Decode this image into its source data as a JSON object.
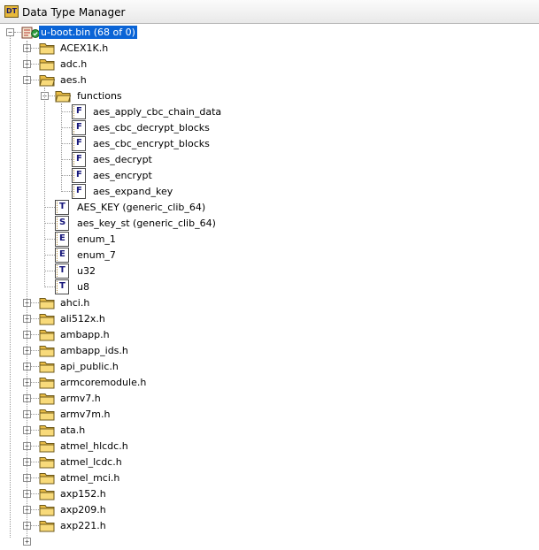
{
  "window": {
    "title": "Data Type Manager"
  },
  "root": {
    "label": "u-boot.bin (68 of 0)"
  },
  "before_aes": [
    "ACEX1K.h",
    "adc.h"
  ],
  "aes": {
    "label": "aes.h",
    "functions_folder": "functions",
    "functions": [
      "aes_apply_cbc_chain_data",
      "aes_cbc_decrypt_blocks",
      "aes_cbc_encrypt_blocks",
      "aes_decrypt",
      "aes_encrypt",
      "aes_expand_key"
    ],
    "types": [
      {
        "label": "AES_KEY  (generic_clib_64)",
        "icon": "typedef-icon",
        "glyph": "T"
      },
      {
        "label": "aes_key_st  (generic_clib_64)",
        "icon": "struct-icon",
        "glyph": "S"
      },
      {
        "label": "enum_1",
        "icon": "enum-icon",
        "glyph": "E"
      },
      {
        "label": "enum_7",
        "icon": "enum-icon",
        "glyph": "E"
      },
      {
        "label": "u32",
        "icon": "typedef-icon",
        "glyph": "T"
      },
      {
        "label": "u8",
        "icon": "typedef-icon",
        "glyph": "T"
      }
    ]
  },
  "after_aes": [
    "ahci.h",
    "ali512x.h",
    "ambapp.h",
    "ambapp_ids.h",
    "api_public.h",
    "armcoremodule.h",
    "armv7.h",
    "armv7m.h",
    "ata.h",
    "atmel_hlcdc.h",
    "atmel_lcdc.h",
    "atmel_mci.h",
    "axp152.h",
    "axp209.h",
    "axp221.h"
  ],
  "icons": {
    "function_glyph": "F",
    "title_glyph": "DT",
    "expand": "+",
    "collapse": "−"
  },
  "colors": {
    "selection": "#0a64d6",
    "folder": "#f2cd62",
    "type_glyph": "#16167a"
  }
}
